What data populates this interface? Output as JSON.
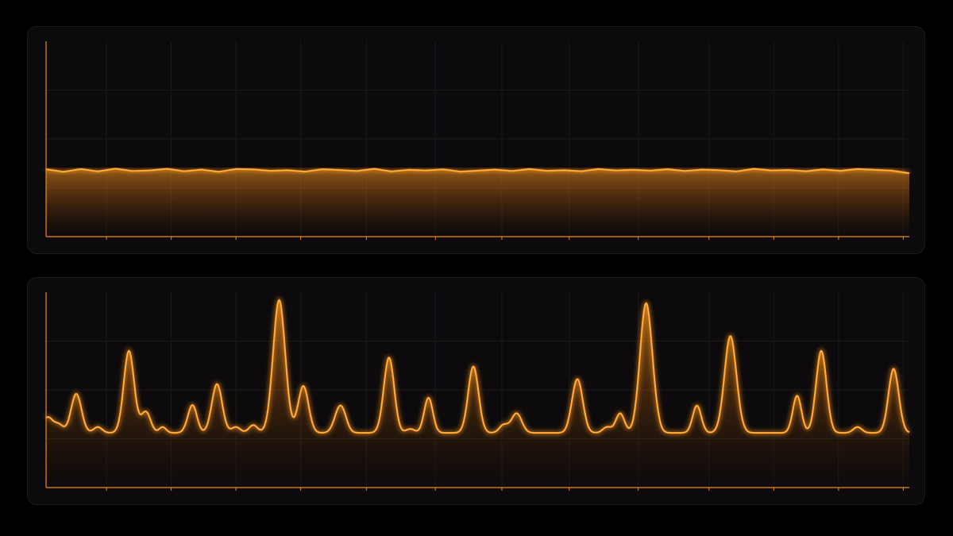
{
  "colors": {
    "background": "#000000",
    "panel": "#0c0a0c",
    "panel_border": "#1d1a1c",
    "line": "#ff9a1f",
    "line_core": "#ffc064",
    "axis": "#f08a18",
    "grid": "#1b191c"
  },
  "chart_data": [
    {
      "type": "area",
      "title": "",
      "xlabel": "",
      "ylabel": "",
      "xlim": [
        0,
        1000
      ],
      "ylim": [
        0,
        100
      ],
      "grid": true,
      "x_ticks": [
        70,
        145,
        220,
        295,
        371,
        451,
        528,
        606,
        686,
        768,
        843,
        918,
        993
      ],
      "series": [
        {
          "x": [
            0,
            20,
            40,
            60,
            80,
            100,
            120,
            140,
            160,
            180,
            200,
            220,
            240,
            260,
            280,
            300,
            320,
            340,
            360,
            380,
            400,
            420,
            440,
            460,
            480,
            500,
            520,
            540,
            560,
            580,
            600,
            620,
            640,
            660,
            680,
            700,
            720,
            740,
            760,
            780,
            800,
            820,
            840,
            860,
            880,
            900,
            920,
            940,
            960,
            980,
            1000
          ],
          "values": [
            34.5,
            33.2,
            34.6,
            33.4,
            34.8,
            33.6,
            33.9,
            34.7,
            33.5,
            34.3,
            33.2,
            34.6,
            34.4,
            33.7,
            34.0,
            33.3,
            34.5,
            34.1,
            33.6,
            34.7,
            33.4,
            34.2,
            33.9,
            34.4,
            33.3,
            33.8,
            34.3,
            33.6,
            34.6,
            33.7,
            34.0,
            33.5,
            34.6,
            33.9,
            34.2,
            33.8,
            34.5,
            33.6,
            34.3,
            34.0,
            33.4,
            34.7,
            33.9,
            34.1,
            33.5,
            34.4,
            33.7,
            34.6,
            34.2,
            33.8,
            32.5
          ]
        }
      ]
    },
    {
      "type": "area",
      "title": "",
      "xlabel": "",
      "ylabel": "",
      "xlim": [
        0,
        1000
      ],
      "ylim": [
        0,
        100
      ],
      "grid": true,
      "x_ticks": [
        70,
        145,
        220,
        295,
        371,
        451,
        528,
        606,
        686,
        768,
        843,
        918,
        993
      ],
      "baseline": 28,
      "noise": [
        {
          "x": 15,
          "h": 4,
          "w": 5
        },
        {
          "x": 60,
          "h": 3,
          "w": 5
        },
        {
          "x": 112,
          "h": 4,
          "w": 5
        },
        {
          "x": 135,
          "h": 3,
          "w": 4
        },
        {
          "x": 165,
          "h": 2,
          "w": 5
        },
        {
          "x": 220,
          "h": 3,
          "w": 5
        },
        {
          "x": 240,
          "h": 4,
          "w": 5
        },
        {
          "x": 345,
          "h": 3,
          "w": 5
        },
        {
          "x": 400,
          "h": 3,
          "w": 5
        },
        {
          "x": 422,
          "h": 2,
          "w": 5
        },
        {
          "x": 530,
          "h": 4,
          "w": 5
        },
        {
          "x": 610,
          "h": 3,
          "w": 5
        },
        {
          "x": 650,
          "h": 3,
          "w": 5
        },
        {
          "x": 705,
          "h": 3,
          "w": 5
        },
        {
          "x": 790,
          "h": 3,
          "w": 5
        },
        {
          "x": 870,
          "h": 3,
          "w": 5
        },
        {
          "x": 940,
          "h": 3,
          "w": 5
        },
        {
          "x": 980,
          "h": 3,
          "w": 5
        }
      ],
      "peaks": [
        {
          "x": 2,
          "h": 8,
          "w": 6
        },
        {
          "x": 35,
          "h": 20,
          "w": 6
        },
        {
          "x": 96,
          "h": 42,
          "w": 6
        },
        {
          "x": 117,
          "h": 8,
          "w": 5
        },
        {
          "x": 170,
          "h": 13,
          "w": 5
        },
        {
          "x": 198,
          "h": 25,
          "w": 6
        },
        {
          "x": 270,
          "h": 68,
          "w": 7
        },
        {
          "x": 298,
          "h": 24,
          "w": 6
        },
        {
          "x": 340,
          "h": 12,
          "w": 6
        },
        {
          "x": 397,
          "h": 36,
          "w": 6
        },
        {
          "x": 443,
          "h": 18,
          "w": 5
        },
        {
          "x": 495,
          "h": 34,
          "w": 6
        },
        {
          "x": 545,
          "h": 10,
          "w": 6
        },
        {
          "x": 616,
          "h": 26,
          "w": 6
        },
        {
          "x": 665,
          "h": 10,
          "w": 5
        },
        {
          "x": 695,
          "h": 66,
          "w": 7
        },
        {
          "x": 754,
          "h": 14,
          "w": 5
        },
        {
          "x": 793,
          "h": 47,
          "w": 7
        },
        {
          "x": 870,
          "h": 16,
          "w": 5
        },
        {
          "x": 898,
          "h": 42,
          "w": 6
        },
        {
          "x": 982,
          "h": 30,
          "w": 6
        }
      ]
    }
  ]
}
